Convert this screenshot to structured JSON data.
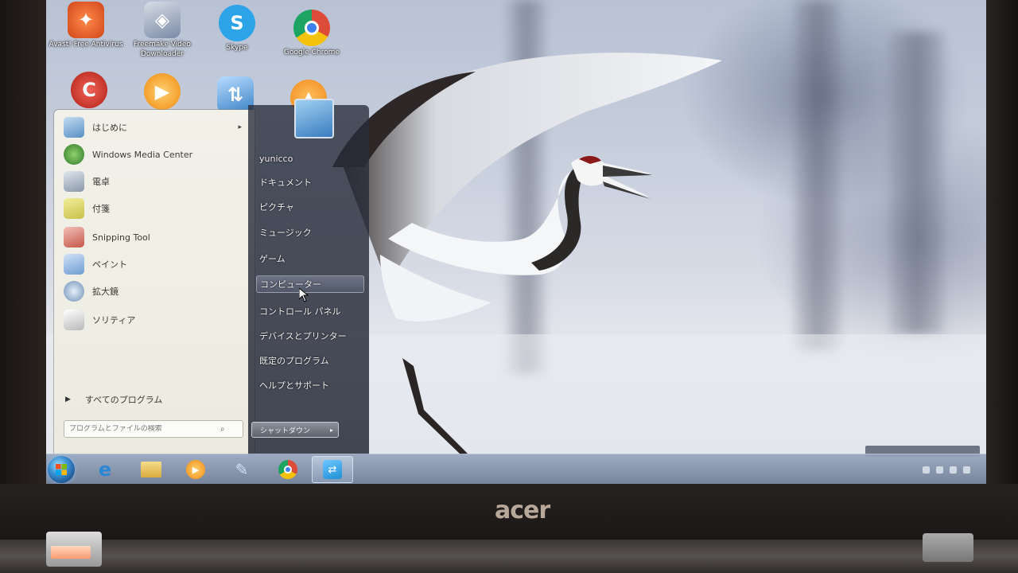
{
  "desktop": {
    "icons": [
      {
        "label": "Avast! Free Antivirus",
        "icon": "avast-icon",
        "color": "#e7551e"
      },
      {
        "label": "Freemake Video Downloader",
        "icon": "freemake-downloader-icon",
        "color": "#7a8aa6"
      },
      {
        "label": "Skype",
        "icon": "skype-icon",
        "color": "#2da4e8"
      },
      {
        "label": "Google Chrome",
        "icon": "chrome-icon",
        "color": "#dd4b39"
      },
      {
        "label": "",
        "icon": "ccleaner-icon",
        "color": "#d42a1e"
      },
      {
        "label": "",
        "icon": "media-player-icon",
        "color": "#f3a01c"
      },
      {
        "label": "",
        "icon": "network-icon",
        "color": "#3b82c6"
      },
      {
        "label": "",
        "icon": "vlc-icon",
        "color": "#f08a1b"
      }
    ]
  },
  "start_menu": {
    "programs": [
      {
        "label": "はじめに",
        "icon": "getting-started-icon",
        "color": "#5a8fc4",
        "has_arrow": true
      },
      {
        "label": "Windows Media Center",
        "icon": "media-center-icon",
        "color": "#4aa04a"
      },
      {
        "label": "電卓",
        "icon": "calculator-icon",
        "color": "#9aa7b6"
      },
      {
        "label": "付箋",
        "icon": "sticky-notes-icon",
        "color": "#d8d26a"
      },
      {
        "label": "Snipping Tool",
        "icon": "scissors-icon",
        "color": "#c6584a"
      },
      {
        "label": "ペイント",
        "icon": "paint-icon",
        "color": "#6f9cd2"
      },
      {
        "label": "拡大鏡",
        "icon": "magnifier-icon",
        "color": "#6b8fb6"
      },
      {
        "label": "ソリティア",
        "icon": "solitaire-icon",
        "color": "#b8b8b8"
      }
    ],
    "all_programs_label": "すべてのプログラム",
    "search_placeholder": "プログラムとファイルの検索",
    "right_items": [
      {
        "label": "yunicco"
      },
      {
        "label": "ドキュメント"
      },
      {
        "label": "ピクチャ"
      },
      {
        "label": "ミュージック"
      },
      {
        "label": "ゲーム"
      },
      {
        "label": "コンピューター",
        "highlighted": true
      },
      {
        "label": "コントロール パネル"
      },
      {
        "label": "デバイスとプリンター"
      },
      {
        "label": "既定のプログラム"
      },
      {
        "label": "ヘルプとサポート"
      }
    ],
    "shutdown_label": "シャットダウン"
  },
  "taskbar": {
    "pinned": [
      {
        "icon": "internet-explorer-icon",
        "color": "#2a86d6"
      },
      {
        "icon": "folder-icon",
        "color": "#e3c064"
      },
      {
        "icon": "media-player-icon",
        "color": "#f39c1c"
      },
      {
        "icon": "paint-brush-icon",
        "color": "#6c9bd4"
      },
      {
        "icon": "chrome-icon",
        "color": "#dd4b39"
      },
      {
        "icon": "teamviewer-icon",
        "color": "#1e8fd4",
        "active": true
      }
    ]
  },
  "laptop": {
    "brand": "acer"
  }
}
